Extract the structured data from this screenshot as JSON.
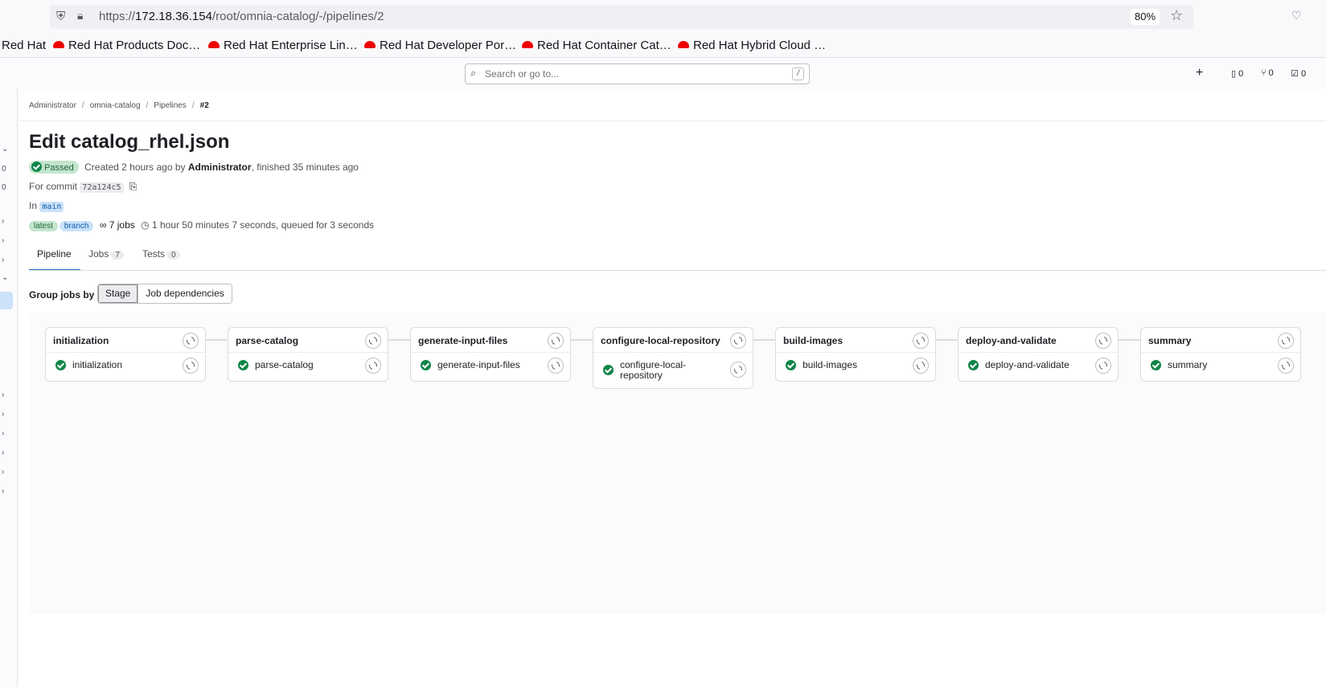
{
  "browser": {
    "url_prefix": "https://",
    "url_host": "172.18.36.154",
    "url_path": "/root/omnia-catalog/-/pipelines/2",
    "zoom": "80%",
    "bookmarks": [
      "Red Hat",
      "Red Hat Products Doc…",
      "Red Hat Enterprise Lin…",
      "Red Hat Developer Por…",
      "Red Hat Container Cat…",
      "Red Hat Hybrid Cloud …"
    ]
  },
  "header": {
    "search_placeholder": "Search or go to...",
    "search_shortcut": "/",
    "new_label": "+",
    "issues_count": "0",
    "mr_count": "0",
    "todos_count": "0"
  },
  "breadcrumb": [
    "Administrator",
    "omnia-catalog",
    "Pipelines",
    "#2"
  ],
  "pipeline": {
    "title": "Edit catalog_rhel.json",
    "status": "Passed",
    "created_text": "Created 2 hours ago by",
    "author": "Administrator",
    "finished_text": ", finished 35 minutes ago",
    "commit_label": "For commit",
    "commit_sha": "72a124c5",
    "in_label": "In",
    "branch": "main",
    "tag_latest": "latest",
    "tag_branch": "branch",
    "jobs_count": "7 jobs",
    "duration": "1 hour 50 minutes 7 seconds, queued for 3 seconds"
  },
  "tabs": [
    {
      "label": "Pipeline",
      "count": null
    },
    {
      "label": "Jobs",
      "count": "7"
    },
    {
      "label": "Tests",
      "count": "0"
    }
  ],
  "groupby": {
    "label": "Group jobs by",
    "options": [
      "Stage",
      "Job dependencies"
    ],
    "selected": "Stage"
  },
  "stages": [
    {
      "name": "initialization",
      "job": "initialization",
      "status": "success"
    },
    {
      "name": "parse-catalog",
      "job": "parse-catalog",
      "status": "success"
    },
    {
      "name": "generate-input-files",
      "job": "generate-input-files",
      "status": "success"
    },
    {
      "name": "configure-local-repository",
      "job": "configure-local-repository",
      "status": "success"
    },
    {
      "name": "build-images",
      "job": "build-images",
      "status": "success"
    },
    {
      "name": "deploy-and-validate",
      "job": "deploy-and-validate",
      "status": "success"
    },
    {
      "name": "summary",
      "job": "summary",
      "status": "success"
    }
  ],
  "colors": {
    "success": "#108548",
    "accent": "#1f75cb"
  }
}
